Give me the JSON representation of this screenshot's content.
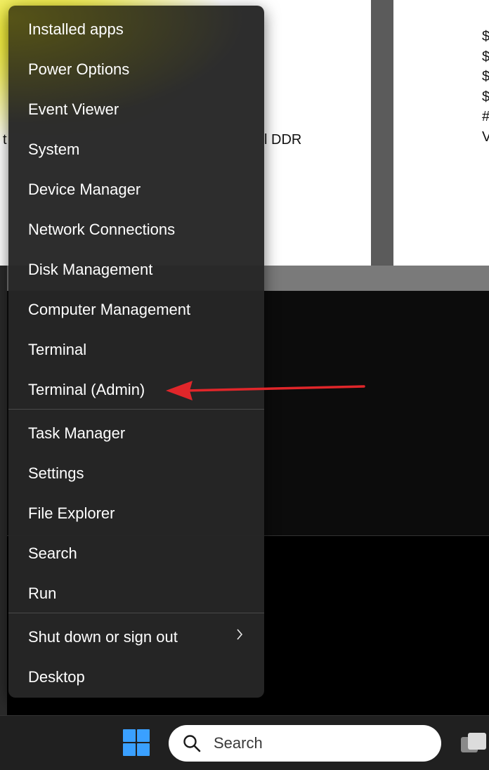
{
  "background": {
    "doc_fragments": [
      "t",
      "l DDR"
    ],
    "right_edge_chars": [
      "$",
      "$",
      "$",
      "$",
      "#",
      "V"
    ]
  },
  "menu": {
    "items": [
      {
        "label": "Installed apps"
      },
      {
        "label": "Power Options"
      },
      {
        "label": "Event Viewer"
      },
      {
        "label": "System"
      },
      {
        "label": "Device Manager"
      },
      {
        "label": "Network Connections"
      },
      {
        "label": "Disk Management"
      },
      {
        "label": "Computer Management"
      },
      {
        "label": "Terminal"
      },
      {
        "label": "Terminal (Admin)",
        "highlighted_by_arrow": true
      },
      {
        "label": "Task Manager"
      },
      {
        "label": "Settings"
      },
      {
        "label": "File Explorer"
      },
      {
        "label": "Search"
      },
      {
        "label": "Run"
      },
      {
        "label": "Shut down or sign out",
        "submenu_icon": "chevron-right-icon"
      },
      {
        "label": "Desktop"
      }
    ]
  },
  "annotation": {
    "type": "arrow",
    "color": "#e0262a",
    "points_to": "Terminal (Admin)"
  },
  "taskbar": {
    "start_icon": "windows-logo-icon",
    "search": {
      "icon": "search-icon",
      "placeholder": "Search"
    },
    "task_view_icon": "task-view-icon"
  },
  "colors": {
    "menu_bg": "#262626",
    "menu_text": "#ffffff",
    "windows_blue": "#3aa0ff"
  }
}
